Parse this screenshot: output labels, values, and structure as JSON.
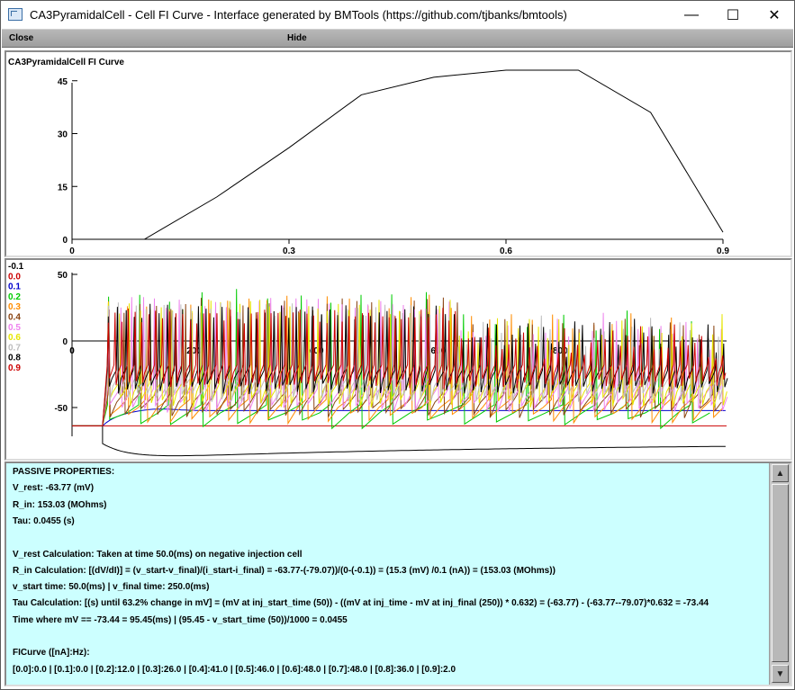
{
  "window": {
    "title": "CA3PyramidalCell - Cell FI Curve - Interface generated by BMTools (https://github.com/tjbanks/bmtools)",
    "minimize": "—",
    "maximize": "☐",
    "close": "✕"
  },
  "menu": {
    "close_label": "Close",
    "hide_label": "Hide"
  },
  "fi_graph": {
    "title": "CA3PyramidalCell FI Curve",
    "y_ticks": [
      "45",
      "30",
      "15",
      "0"
    ],
    "x_ticks": [
      "0",
      "0.3",
      "0.6",
      "0.9"
    ]
  },
  "chart_data": [
    {
      "type": "line",
      "title": "CA3PyramidalCell FI Curve",
      "xlabel": "",
      "ylabel": "",
      "x": [
        0.0,
        0.1,
        0.2,
        0.3,
        0.4,
        0.5,
        0.6,
        0.7,
        0.8,
        0.9
      ],
      "series": [
        {
          "values": [
            0,
            0,
            12,
            26,
            41,
            46,
            48,
            48,
            36,
            2
          ]
        }
      ],
      "xlim": [
        0,
        0.9
      ],
      "ylim": [
        0,
        48
      ],
      "grid": false
    },
    {
      "type": "line",
      "title": "",
      "xlabel": "",
      "ylabel": "",
      "xlim": [
        0,
        600
      ],
      "ylim": [
        -90,
        50
      ],
      "y_ticks": [
        "50",
        "0",
        "-50"
      ],
      "x_ticks": [
        "0",
        "200",
        "400",
        "600",
        "800"
      ],
      "series": [
        {
          "name": "-0.1",
          "color": "#000000",
          "steady": -79.07
        },
        {
          "name": "0.0",
          "color": "#cc0000",
          "steady": -63.77
        },
        {
          "name": "0.1",
          "color": "#0000cc",
          "steady": -52
        },
        {
          "name": "0.2",
          "color": "#00cc00"
        },
        {
          "name": "0.3",
          "color": "#ff8c00"
        },
        {
          "name": "0.4",
          "color": "#8b4513"
        },
        {
          "name": "0.5",
          "color": "#ee82ee"
        },
        {
          "name": "0.6",
          "color": "#e6e600"
        },
        {
          "name": "0.7",
          "color": "#bdbdbd"
        },
        {
          "name": "0.8",
          "color": "#000000"
        },
        {
          "name": "0.9",
          "color": "#cc0000"
        }
      ]
    }
  ],
  "info": {
    "lines": [
      "PASSIVE PROPERTIES:",
      "V_rest: -63.77 (mV)",
      "R_in: 153.03 (MOhms)",
      "Tau: 0.0455 (s)",
      "",
      "V_rest Calculation: Taken at time 50.0(ms) on negative injection cell",
      "R_in Calculation: [(dV/dI)] = (v_start-v_final)/(i_start-i_final) = -63.77-(-79.07))/(0-(-0.1)) = (15.3 (mV) /0.1 (nA)) = (153.03 (MOhms))",
      "v_start time: 50.0(ms) | v_final time: 250.0(ms)",
      "Tau Calculation: [(s) until 63.2% change in mV] = (mV at inj_start_time (50)) - ((mV at inj_time  - mV at inj_final (250)) * 0.632) = (-63.77) - (-63.77--79.07)*0.632 = -73.44",
      "Time where mV == -73.44 = 95.45(ms) | (95.45 - v_start_time (50))/1000 = 0.0455",
      "",
      "FICurve ([nA]:Hz):",
      "[0.0]:0.0 | [0.1]:0.0 | [0.2]:12.0 | [0.3]:26.0 | [0.4]:41.0 | [0.5]:46.0 | [0.6]:48.0 | [0.7]:48.0 | [0.8]:36.0 | [0.9]:2.0"
    ]
  },
  "scrollbar": {
    "up": "▲",
    "down": "▼"
  }
}
